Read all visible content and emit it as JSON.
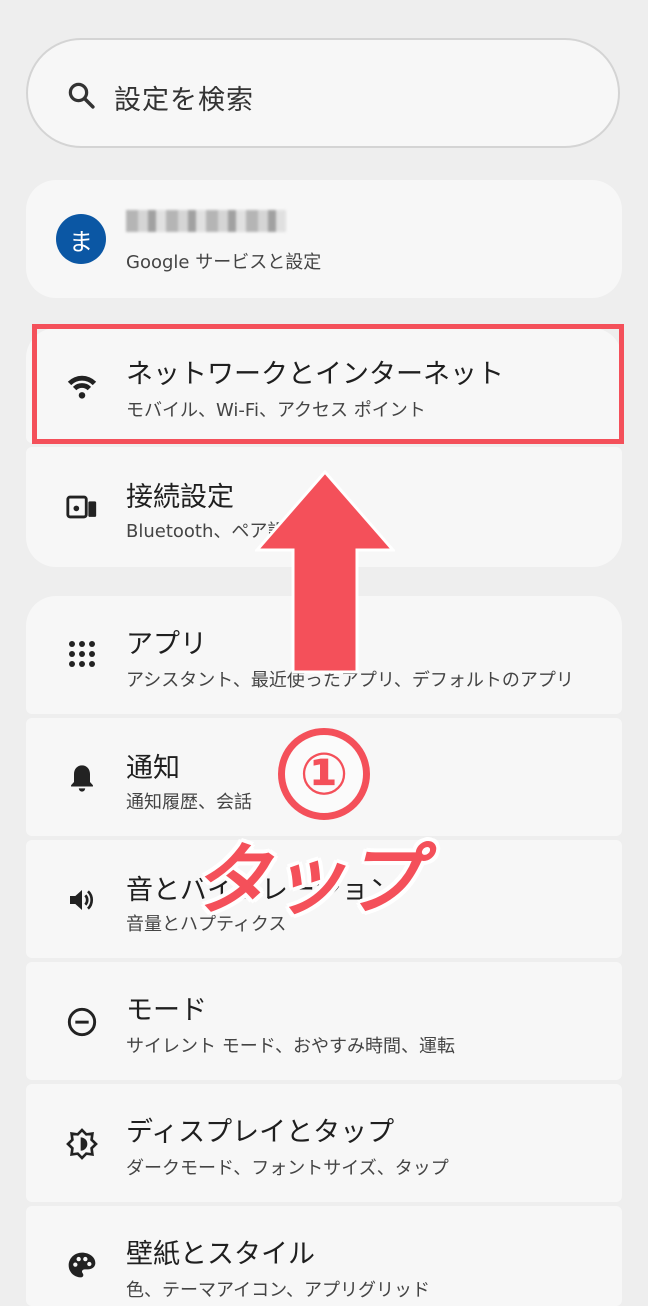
{
  "search": {
    "placeholder": "設定を検索"
  },
  "account": {
    "avatar_letter": "ま",
    "subtitle": "Google サービスと設定"
  },
  "settings": [
    {
      "title": "ネットワークとインターネット",
      "subtitle": "モバイル、Wi-Fi、アクセス ポイント",
      "icon": "wifi-icon"
    },
    {
      "title": "接続設定",
      "subtitle": "Bluetooth、ペア設",
      "icon": "connected-devices-icon"
    },
    {
      "title": "アプリ",
      "subtitle": "アシスタント、最近使ったアプリ、デフォルトのアプリ",
      "icon": "apps-grid-icon"
    },
    {
      "title": "通知",
      "subtitle": "通知履歴、会話",
      "icon": "bell-icon"
    },
    {
      "title": "音とバイブレーション",
      "subtitle": "音量とハプティクス",
      "icon": "volume-icon"
    },
    {
      "title": "モード",
      "subtitle": "サイレント モード、おやすみ時間、運転",
      "icon": "do-not-disturb-icon"
    },
    {
      "title": "ディスプレイとタップ",
      "subtitle": "ダークモード、フォントサイズ、タップ",
      "icon": "display-brightness-icon"
    },
    {
      "title": "壁紙とスタイル",
      "subtitle": "色、テーマアイコン、アプリグリッド",
      "icon": "palette-icon"
    }
  ],
  "annotation": {
    "step_number": "①",
    "instruction": "タップ",
    "color": "#f4505a"
  }
}
